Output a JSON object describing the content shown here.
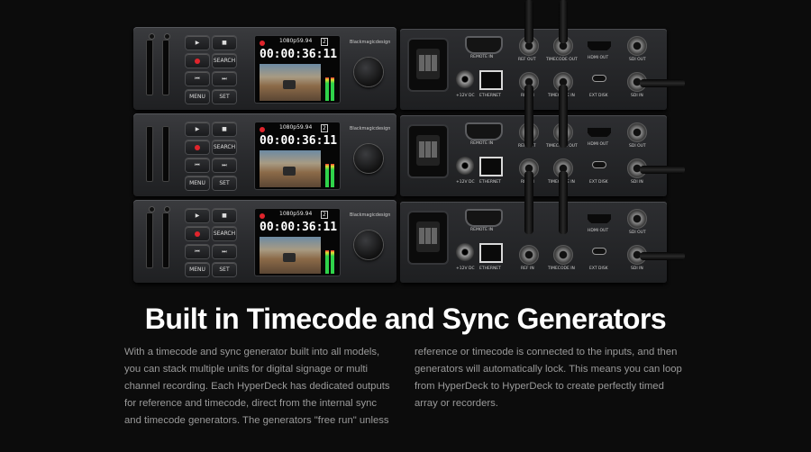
{
  "hero": {
    "units": [
      {
        "format": "1080p59.94",
        "timecode": "00:00:36:11",
        "brand": "Blackmagicdesign",
        "search_label": "SEARCH",
        "menu_label": "MENU",
        "set_label": "SET",
        "slot": "2"
      },
      {
        "format": "1080p59.94",
        "timecode": "00:00:36:11",
        "brand": "Blackmagicdesign",
        "search_label": "SEARCH",
        "menu_label": "MENU",
        "set_label": "SET",
        "slot": "2"
      },
      {
        "format": "1080p59.94",
        "timecode": "00:00:36:11",
        "brand": "Blackmagicdesign",
        "search_label": "SEARCH",
        "menu_label": "MENU",
        "set_label": "SET",
        "slot": "2"
      }
    ],
    "rear_labels": {
      "remote_in": "REMOTE IN",
      "ref_out": "REF OUT",
      "timecode_out": "TIMECODE OUT",
      "hdmi_out": "HDMI OUT",
      "sdi_out": "SDI OUT",
      "dc": "+12V DC",
      "ethernet": "ETHERNET",
      "ref_in": "REF IN",
      "timecode_in": "TIMECODE IN",
      "ext_disk": "EXT DISK",
      "sdi_in": "SDI IN"
    }
  },
  "section": {
    "title": "Built in Timecode and Sync Generators",
    "left_paragraph": "With a timecode and sync generator built into all models, you can stack multiple units for digital signage or multi channel recording. Each HyperDeck has dedicated outputs for reference and timecode, direct from the internal sync and timecode generators. The generators \"free run\" unless",
    "right_paragraph": "reference or timecode is connected to the inputs, and then generators will automatically lock. This means you can loop from HyperDeck to HyperDeck to create perfectly timed array or recorders."
  },
  "colors": {
    "background": "#0c0c0c",
    "title": "#ffffff",
    "body_text": "#9a9a9a",
    "record": "#e0242c",
    "meter": "#2fd34a"
  }
}
